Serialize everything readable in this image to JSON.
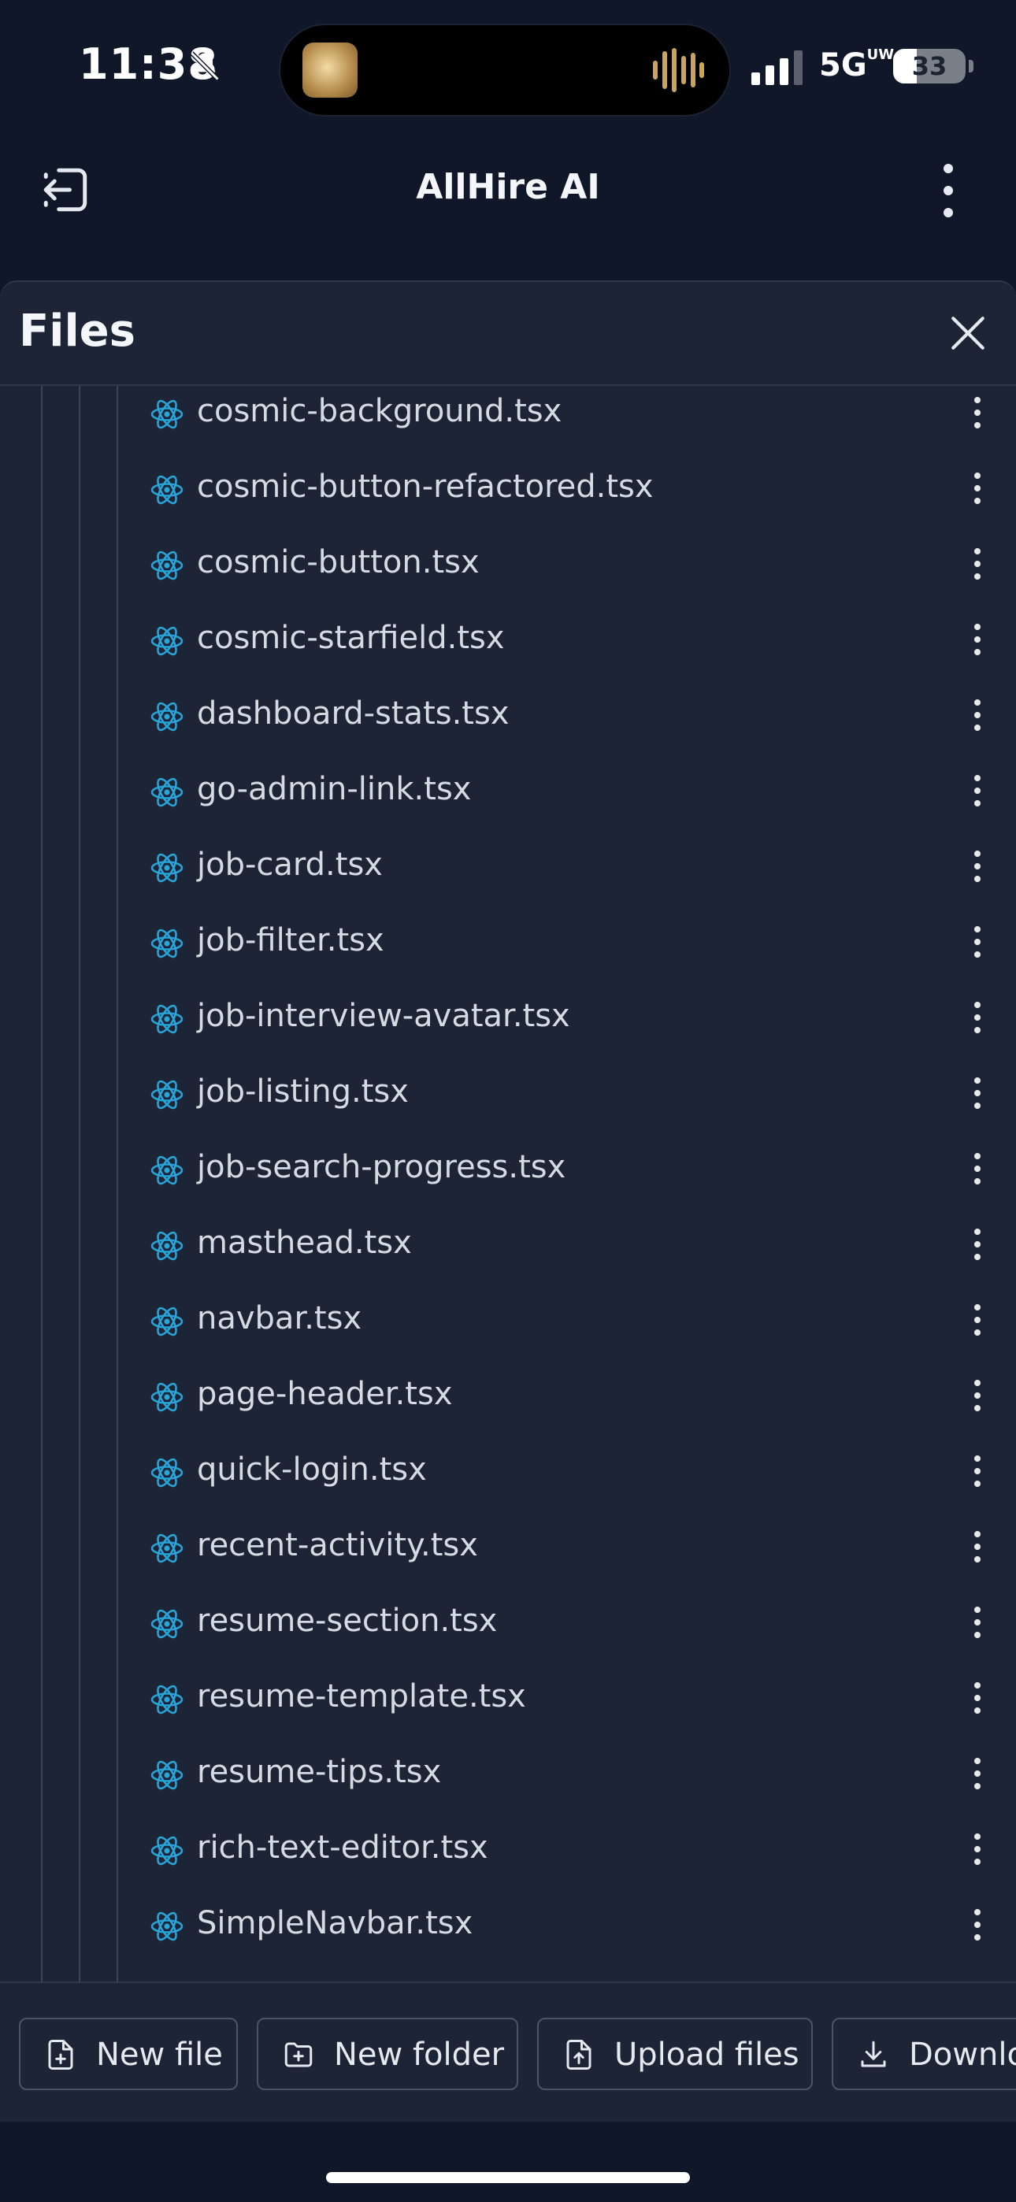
{
  "status_bar": {
    "time": "11:38",
    "network": "5G",
    "network_sup": "UW",
    "battery": "33",
    "battery_level": 0.33
  },
  "header": {
    "title": "AllHire AI",
    "left_icon": "exit-icon",
    "right_icon": "more-vertical-icon"
  },
  "panel": {
    "title": "Files",
    "files": [
      "cosmic-background.tsx",
      "cosmic-button-refactored.tsx",
      "cosmic-button.tsx",
      "cosmic-starfield.tsx",
      "dashboard-stats.tsx",
      "go-admin-link.tsx",
      "job-card.tsx",
      "job-filter.tsx",
      "job-interview-avatar.tsx",
      "job-listing.tsx",
      "job-search-progress.tsx",
      "masthead.tsx",
      "navbar.tsx",
      "page-header.tsx",
      "quick-login.tsx",
      "recent-activity.tsx",
      "resume-section.tsx",
      "resume-template.tsx",
      "resume-tips.tsx",
      "rich-text-editor.tsx",
      "SimpleNavbar.tsx",
      ""
    ]
  },
  "toolbar": {
    "new_file": "New file",
    "new_folder": "New folder",
    "upload_files": "Upload files",
    "download": "Download"
  },
  "colors": {
    "background": "#0f1729",
    "panel": "#1d2435",
    "react_icon": "#2aa4d8"
  }
}
